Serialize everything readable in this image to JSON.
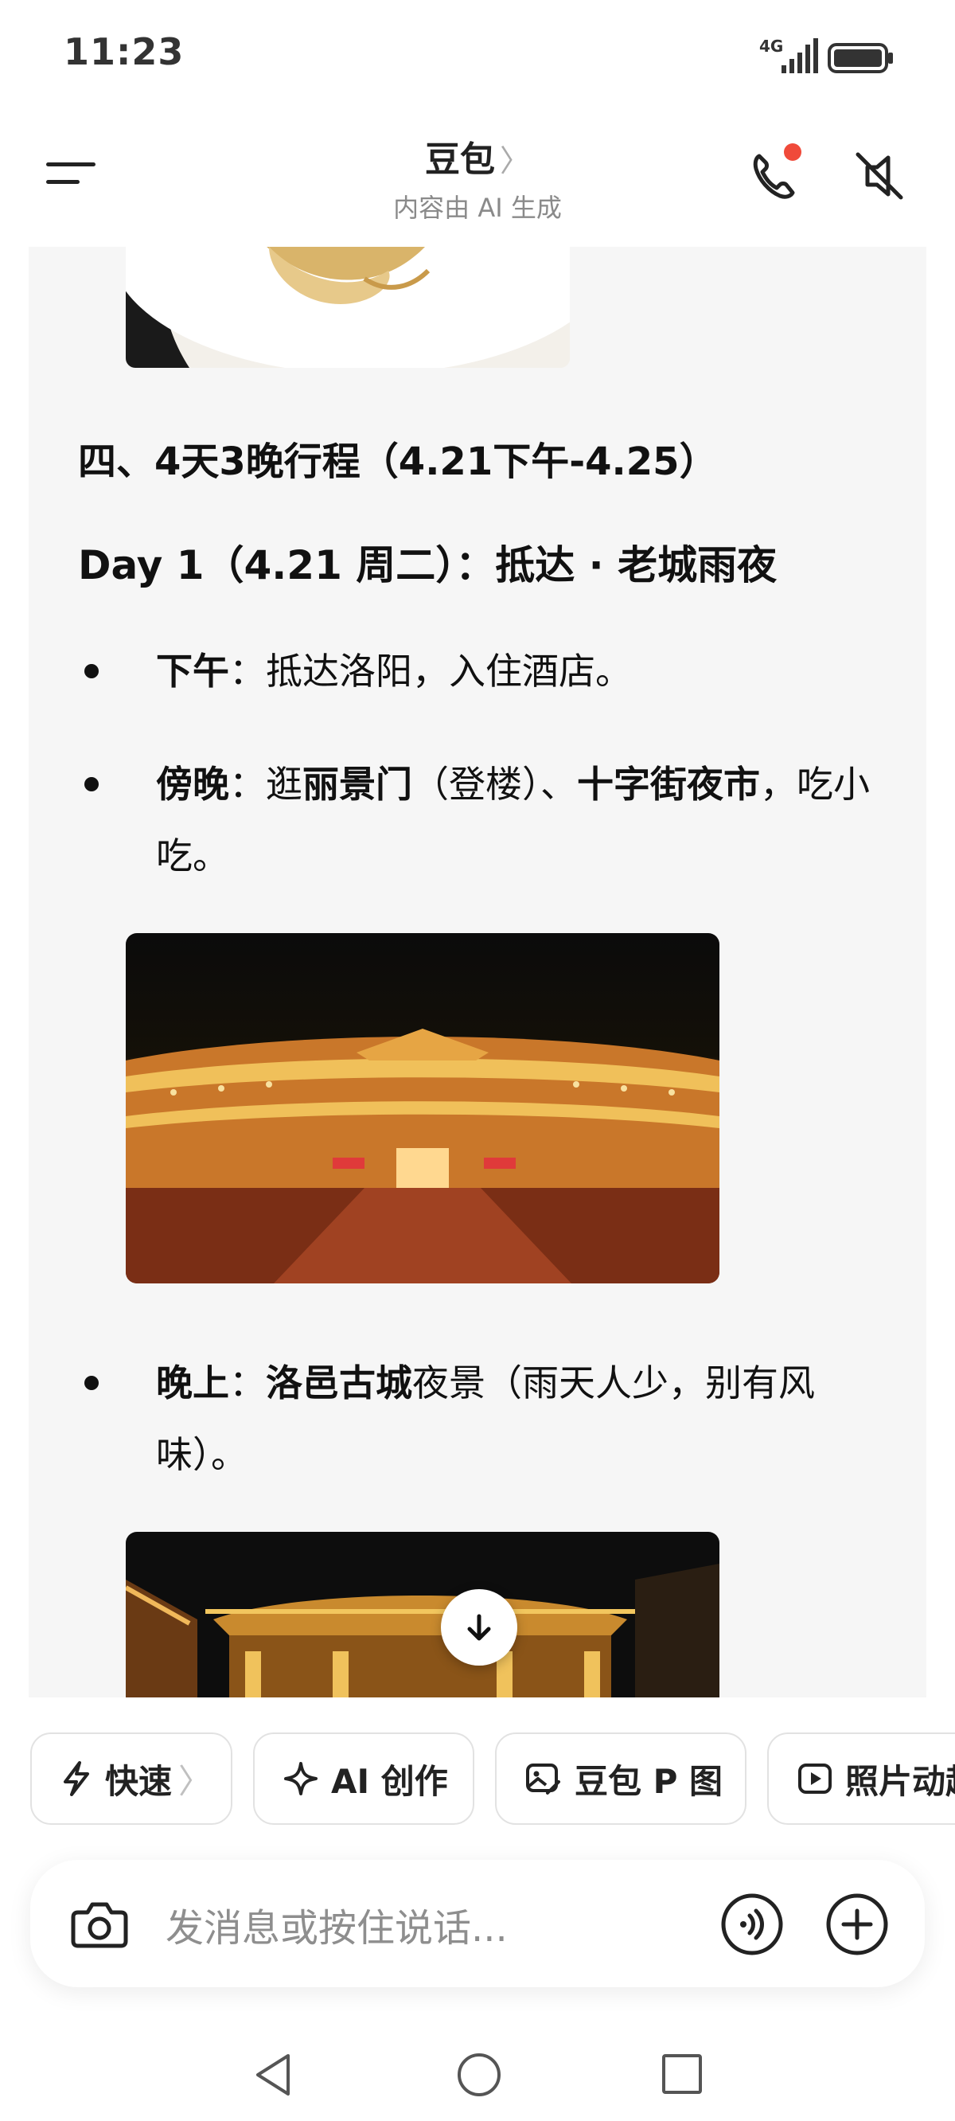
{
  "status_bar": {
    "time": "11:23",
    "network": "4G"
  },
  "header": {
    "title": "豆包",
    "title_chevron": "〉",
    "subtitle": "内容由 AI 生成"
  },
  "chat": {
    "section_heading": "四、4天3晚行程（4.21下午-4.25）",
    "day_heading": "Day 1（4.21 周二）：抵达 · 老城雨夜",
    "items": [
      {
        "label": "下午",
        "sep": "：",
        "text": "抵达洛阳，入住酒店。"
      },
      {
        "label": "傍晚",
        "sep": "：",
        "text_a": "逛",
        "bold_a": "丽景门",
        "text_b": "（登楼）、",
        "bold_b": "十字街夜市",
        "text_c": "，吃小吃。"
      },
      {
        "label": "晚上",
        "sep": "：",
        "bold_a": "洛邑古城",
        "text_a": "夜景（雨天人少，别有风味）。"
      }
    ]
  },
  "chips": [
    {
      "label": "快速",
      "icon": "lightning-icon",
      "chevron": "〉"
    },
    {
      "label": "AI 创作",
      "icon": "sparkle-icon"
    },
    {
      "label": "豆包 P 图",
      "icon": "image-edit-icon"
    },
    {
      "label": "照片动起",
      "icon": "play-icon"
    }
  ],
  "input": {
    "placeholder": "发消息或按住说话..."
  }
}
